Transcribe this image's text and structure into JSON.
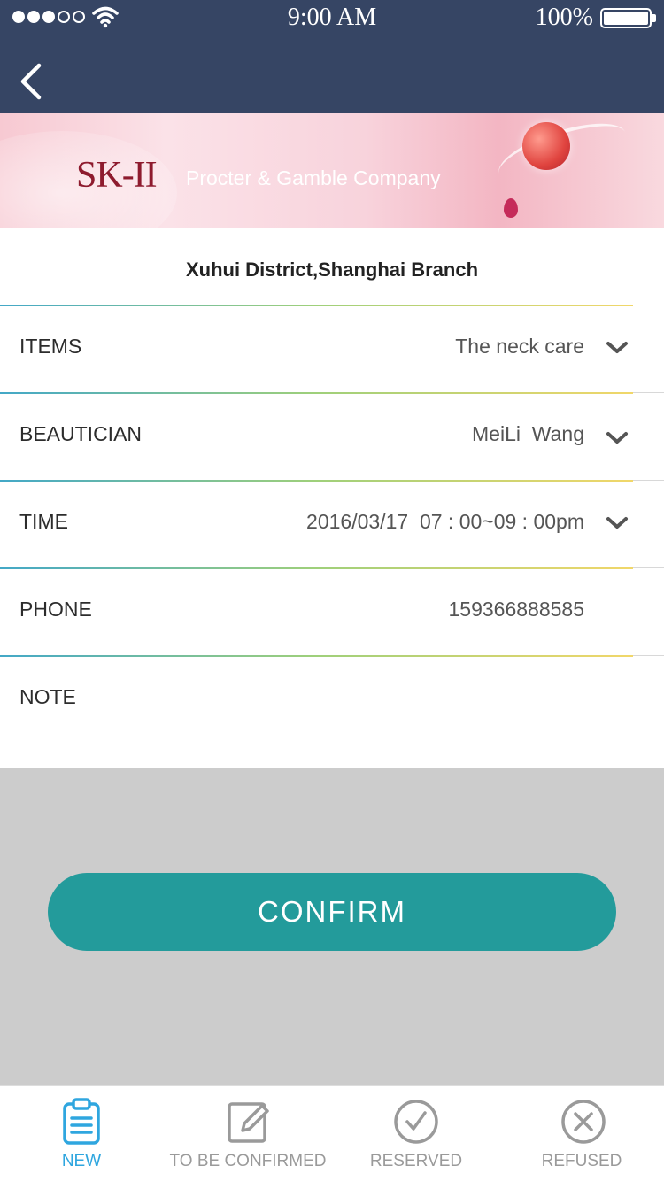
{
  "status_bar": {
    "time": "9:00 AM",
    "battery_percent": "100%",
    "signal_strength": 3,
    "signal_total": 5
  },
  "nav": {
    "back_icon": "chevron-left-icon"
  },
  "banner": {
    "brand": "SK-II",
    "company": "Procter & Gamble Company"
  },
  "branch": {
    "name": "Xuhui District,Shanghai Branch"
  },
  "form": {
    "items": {
      "label": "ITEMS",
      "value": "The neck care"
    },
    "beautician": {
      "label": "BEAUTICIAN",
      "value": "MeiLi  Wang"
    },
    "time": {
      "label": "TIME",
      "value": "2016/03/17  07 : 00~09 : 00pm"
    },
    "phone": {
      "label": "PHONE",
      "value": "159366888585"
    },
    "note": {
      "label": "NOTE",
      "value": ""
    }
  },
  "confirm": {
    "label": "CONFIRM"
  },
  "tabs": [
    {
      "label": "NEW",
      "icon": "clipboard-icon",
      "active": true
    },
    {
      "label": "TO BE CONFIRMED",
      "icon": "edit-icon",
      "active": false
    },
    {
      "label": "RESERVED",
      "icon": "check-circle-icon",
      "active": false
    },
    {
      "label": "REFUSED",
      "icon": "x-circle-icon",
      "active": false
    }
  ],
  "colors": {
    "nav_bg": "#364564",
    "accent": "#239b9b",
    "tab_active": "#2fa6df",
    "tab_inactive": "#9a9a9a",
    "grey_bg": "#cccccc"
  }
}
